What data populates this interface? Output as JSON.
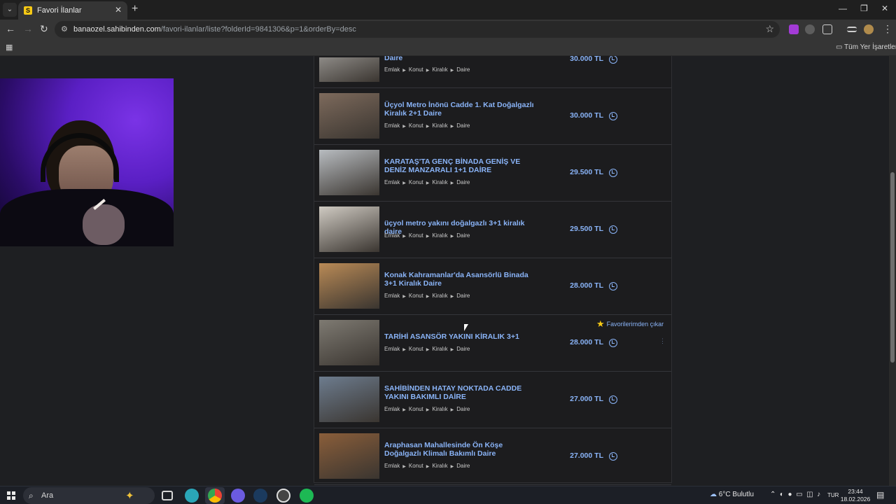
{
  "browser": {
    "tab_title": "Favori İlanlar",
    "url_host": "banaozel.sahibinden.com",
    "url_path": "/favori-ilanlar/liste?folderId=9841306&p=1&orderBy=desc",
    "bookmarks_all": "Tüm Yer İşaretleri"
  },
  "listings": [
    {
      "title": "Daire",
      "crumbs": [
        "Emlak",
        "Konut",
        "Kiralık",
        "Daire"
      ],
      "price": "30.000 TL",
      "thumb": "#8d8a86"
    },
    {
      "title": "Üçyol Metro İnönü Cadde 1. Kat Doğalgazlı Kiralık 2+1 Daire",
      "crumbs": [
        "Emlak",
        "Konut",
        "Kiralık",
        "Daire"
      ],
      "price": "30.000 TL",
      "thumb": "#7d6a5c"
    },
    {
      "title": "KARATAŞ'TA GENÇ BİNADA GENİŞ VE DENİZ MANZARALI 1+1 DAİRE",
      "crumbs": [
        "Emlak",
        "Konut",
        "Kiralık",
        "Daire"
      ],
      "price": "29.500 TL",
      "thumb": "#b8bcc0"
    },
    {
      "title": "üçyol metro yakını doğalgazlı 3+1 kiralık daire",
      "crumbs": [
        "Emlak",
        "Konut",
        "Kiralık",
        "Daire"
      ],
      "price": "29.500 TL",
      "thumb": "#cfcac2"
    },
    {
      "title": "Konak Kahramanlar'da Asansörlü Binada 3+1 Kiralık Daire",
      "crumbs": [
        "Emlak",
        "Konut",
        "Kiralık",
        "Daire"
      ],
      "price": "28.000 TL",
      "thumb": "#b98a56"
    },
    {
      "title": "TARİHİ ASANSÖR YAKINI KİRALIK 3+1",
      "crumbs": [
        "Emlak",
        "Konut",
        "Kiralık",
        "Daire"
      ],
      "price": "28.000 TL",
      "thumb": "#7e7a72"
    },
    {
      "title": "SAHİBİNDEN HATAY NOKTADA CADDE YAKINI BAKIMLI DAİRE",
      "crumbs": [
        "Emlak",
        "Konut",
        "Kiralık",
        "Daire"
      ],
      "price": "27.000 TL",
      "thumb": "#6d7c8e"
    },
    {
      "title": "Araphasan Mahallesinde Ön Köşe Doğalgazlı Klimalı Bakımlı Daire",
      "crumbs": [
        "Emlak",
        "Konut",
        "Kiralık",
        "Daire"
      ],
      "price": "27.000 TL",
      "thumb": "#8a5e3a"
    }
  ],
  "favorite_remove_label": "Favorilerimden çıkar",
  "taskbar": {
    "search_label": "Ara",
    "weather": "6°C Bulutlu",
    "lang": "TUR",
    "time": "23:44",
    "date": "18.02.2026"
  }
}
